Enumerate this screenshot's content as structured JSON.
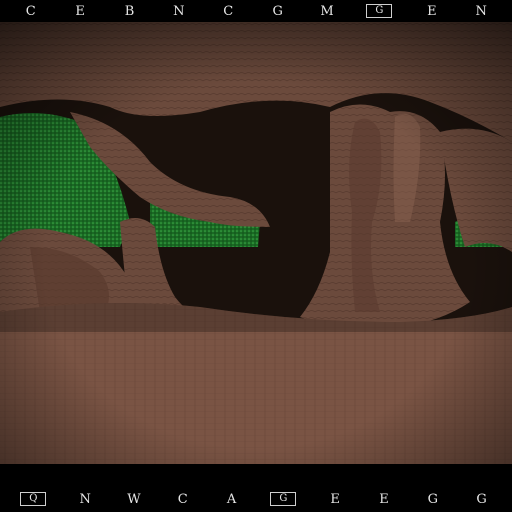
{
  "hud": {
    "top_glyphs": [
      "C",
      "E",
      "B",
      "N",
      "C",
      "G",
      "M",
      "G",
      "E",
      "N"
    ],
    "bottom_glyphs": [
      "Q",
      "N",
      "W",
      "C",
      "A",
      "G",
      "E",
      "E",
      "G",
      "G"
    ]
  },
  "colors": {
    "rock": "#6b4a3c",
    "rock_dark": "#3a2820",
    "floor": "#7a5444",
    "foliage": "#1f7a2a",
    "sky": "#000000"
  }
}
